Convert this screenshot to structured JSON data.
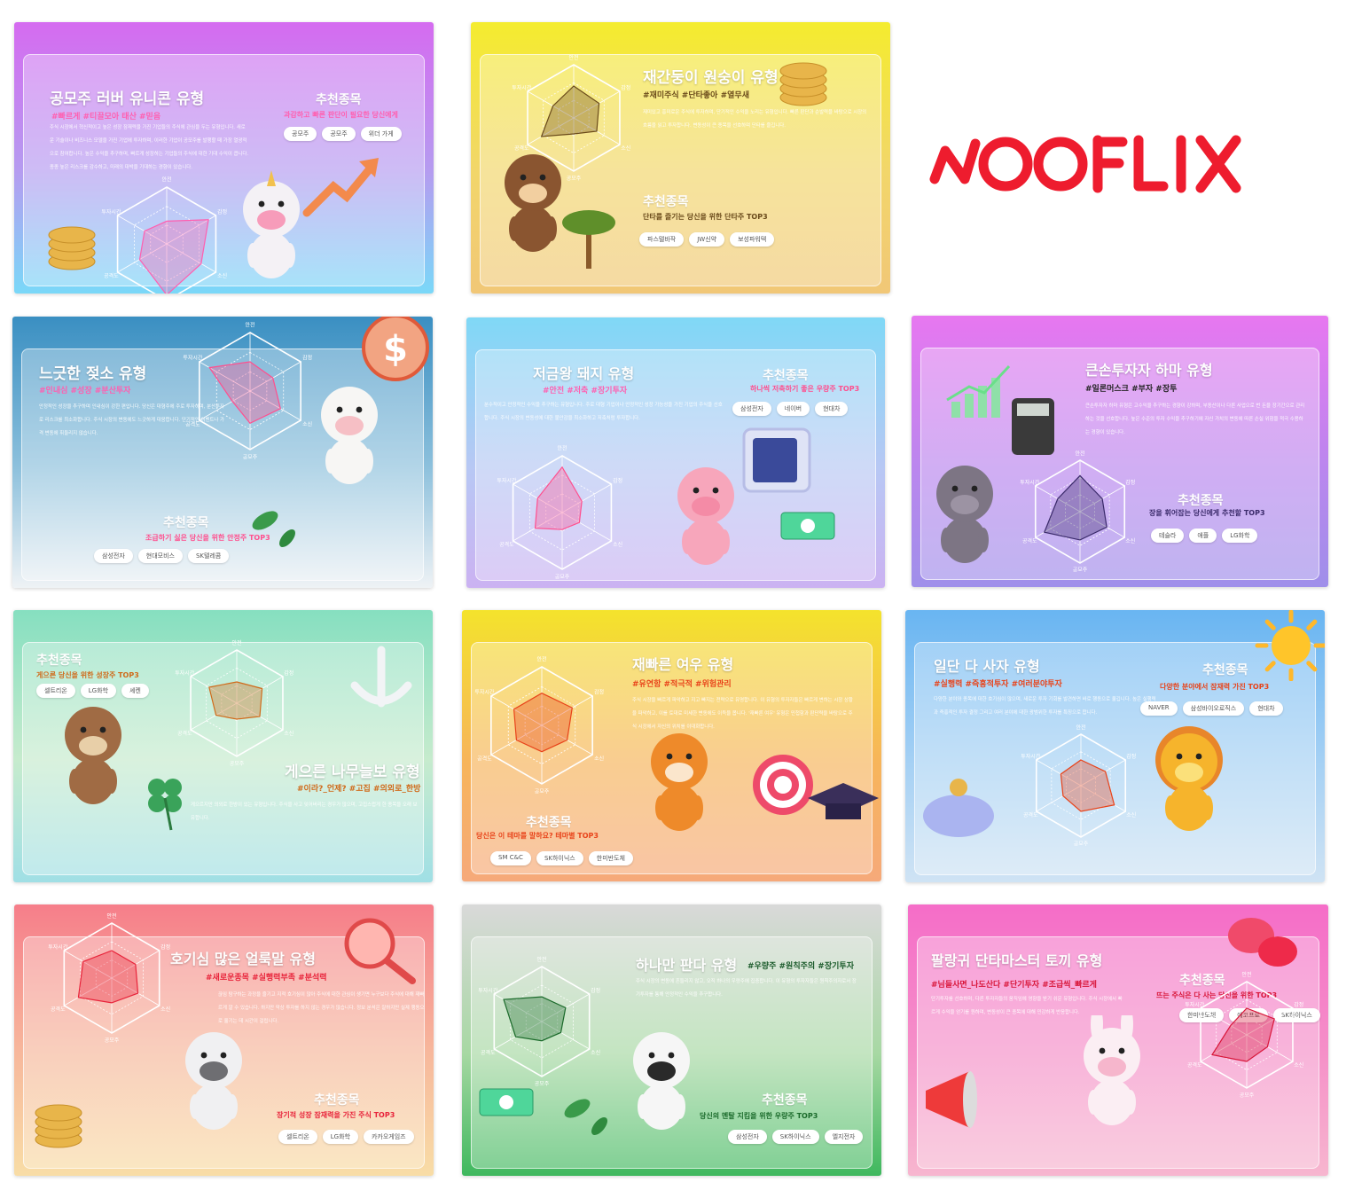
{
  "logo": {
    "text": "NOOFLIX",
    "color": "#ee1c2e"
  },
  "radar_axes": [
    "안전",
    "감정",
    "소신",
    "공모주",
    "공격도",
    "투자시간"
  ],
  "cards": [
    {
      "id": "unicorn",
      "mascot": "unicorn-icon",
      "bg": [
        "#d56bf0",
        "#b59cf0",
        "#7ad8f8"
      ],
      "title": "공모주 러버 유니콘 유형",
      "tags": "#빠르게 #티끌모아 태산 #믿음",
      "tag_color": "#ff5fb0",
      "desc": "주식 시장에서 혁신적이고 높은 성장 잠재력을 가진 기업들의 주식에 관심을 두는 유형입니다. 새로운 기술이나 비즈니스 모델을 가진 기업에 투자하며, 이러한 기업이 공모주를 발행할 때 가장 열광적으로 참여합니다. 높은 수익을 추구하며, 빠르게 성장하는 기업들의 주식에 대한 기대 수익이 큽니다. 종종 높은 리스크를 감수하고, 미래의 대박을 기대하는 경향이 있습니다.",
      "rec_title": "추천종목",
      "rec_sub": "과감하고 빠른 판단이 필요한 당신에게",
      "rec_color": "#ff5fb0",
      "stocks": [
        "공모주",
        "공모주",
        "위더 가게"
      ],
      "radar": [
        0.4,
        0.85,
        0.7,
        0.9,
        0.55,
        0.45
      ]
    },
    {
      "id": "monkey",
      "mascot": "monkey-icon",
      "bg": [
        "#f4ec2e",
        "#f2d66a",
        "#f1c777"
      ],
      "title": "재간둥이 원숭이 유형",
      "tags": "#재미주식 #단타좋아 #열무새",
      "tag_color": "#6a4a1a",
      "desc": "재미있고 흥미로운 주식에 투자하며, 단기적인 수익을 노리는 유형입니다. 빠른 판단과 순발력을 바탕으로 시장의 흐름을 읽고 투자합니다. 변동성이 큰 종목을 선호하며 단타를 즐깁니다.",
      "rec_title": "추천종목",
      "rec_sub": "단타를 즐기는 당신을 위한 단타주 TOP3",
      "rec_color": "#6a4a1a",
      "stocks": [
        "파스텔바작",
        "JW신약",
        "보성파워텍"
      ],
      "radar": [
        0.6,
        0.55,
        0.5,
        0.3,
        0.7,
        0.45
      ]
    },
    {
      "id": "cow",
      "mascot": "cow-icon",
      "bg": [
        "#3a8fc2",
        "#8cc0dc",
        "#eef2f5"
      ],
      "title": "느긋한 젖소 유형",
      "tags": "#인내심 #성장 #분산투자",
      "tag_color": "#ff5fb0",
      "desc": "안정적인 성장을 추구하며 인내심이 강한 편입니다. 당신은 대형주에 주로 투자하며, 분산투자로 리스크를 최소화합니다. 주식 시장의 변동에도 느긋하게 대응합니다. 단기적인 이벤트나 가격 변동에 휘둘리지 않습니다.",
      "rec_title": "추천종목",
      "rec_sub": "조급하기 싫은 당신을 위한 안정주 TOP3",
      "rec_color": "#ff4f8e",
      "stocks": [
        "삼성전자",
        "현대모비스",
        "SK텔레콤"
      ],
      "radar": [
        0.5,
        0.45,
        0.6,
        0.55,
        0.35,
        0.8
      ]
    },
    {
      "id": "pig",
      "mascot": "pig-icon",
      "bg": [
        "#80d8f6",
        "#b7c8f4",
        "#cbb2f2"
      ],
      "title": "저금왕 돼지 유형",
      "tags": "#안전 #저축 #장기투자",
      "tag_color": "#ff5fb0",
      "desc": "분수적이고 안정적인 수익을 추구하는 유형입니다. 주로 대형 기업이나 안정적인 성장 가능성을 가진 기업의 주식을 선호합니다. 주식 시장의 변동성에 대한 불안감을 최소화하고 저축처럼 투자합니다.",
      "rec_title": "추천종목",
      "rec_sub": "하나씩 저축하기 좋은 우량주 TOP3",
      "rec_color": "#ff4f8e",
      "stocks": [
        "삼성전자",
        "네이버",
        "현대차"
      ],
      "radar": [
        0.8,
        0.4,
        0.35,
        0.3,
        0.55,
        0.5
      ]
    },
    {
      "id": "hippo",
      "mascot": "hippo-icon",
      "bg": [
        "#e777f0",
        "#bb86ee",
        "#9f8fea"
      ],
      "title": "큰손투자자 하마 유형",
      "tags": "#일론머스크 #부자 #장투",
      "tag_color": "#222222",
      "desc": "큰손투자자 하마 유형은 고수익을 추구하는 경향이 강하며, 부동산이나 다른 사업으로 번 돈을 장기간으로 관리하는 것을 선호합니다. 높은 수준의 투자 수익을 추구하기에 자신 가치의 변동에 따른 손실 위험을 적극 수용하는 경향이 있습니다.",
      "rec_title": "추천종목",
      "rec_sub": "장을 휘어잡는 당신에게 추천할 TOP3",
      "rec_color": "#3a2a6a",
      "stocks": [
        "테슬라",
        "애플",
        "LG화학"
      ],
      "radar": [
        0.7,
        0.5,
        0.6,
        0.55,
        0.8,
        0.5
      ]
    },
    {
      "id": "sloth",
      "mascot": "sloth-icon",
      "bg": [
        "#86dfc0",
        "#c6ebcd",
        "#a0dfe5"
      ],
      "title": "게으른 나무늘보 유형",
      "tags": "#이라?_언제? #고집 #의외로_한방",
      "tag_color": "#d06a1a",
      "desc": "게으르지만 의외로 한방이 있는 유형입니다. 주식을 사고 잊어버리는 경우가 많으며, 고집스럽게 한 종목을 오래 보유합니다.",
      "rec_title": "추천종목",
      "rec_sub": "게으른 당신을 위한 성장주 TOP3",
      "rec_color": "#d06a1a",
      "stocks": [
        "셀트리온",
        "LG화학",
        "셰켄"
      ],
      "radar": [
        0.4,
        0.55,
        0.5,
        0.3,
        0.45,
        0.6
      ]
    },
    {
      "id": "fox",
      "mascot": "fox-icon",
      "bg": [
        "#f4e32c",
        "#f7b55a",
        "#f6a97a"
      ],
      "title": "재빠른 여우 유형",
      "tags": "#유연함 #적극적 #위험관리",
      "tag_color": "#e8431a",
      "desc": "주식 시장을 빠르게 파악하고 지고 빠지는 전략으로 유명합니다. 이 유형의 투자자들은 빠르게 변하는 시장 상황을 파악하고, 이를 토대로 미세한 변동에도 이득을 봅니다. '재빠른 여우' 유형은 민첩함과 판단력을 바탕으로 주식 시장에서 자신의 위치를 이대화합니다.",
      "rec_title": "추천종목",
      "rec_sub": "당신은 이 테마를 말하요? 테마별 TOP3",
      "rec_color": "#e8431a",
      "stocks": [
        "SM C&C",
        "SK하이닉스",
        "한미반도체"
      ],
      "radar": [
        0.55,
        0.6,
        0.5,
        0.45,
        0.5,
        0.55
      ]
    },
    {
      "id": "lion",
      "mascot": "lion-icon",
      "bg": [
        "#69b5f2",
        "#a4d0f4",
        "#cfe3f4"
      ],
      "title": "일단 다 사자 유형",
      "tags": "#실행력 #즉흥적투자 #여러분야투자",
      "tag_color": "#e8431a",
      "desc": "다양한 분야와 종목에 대한 호기심이 많으며, 새로운 투자 기회를 발견하면 바로 행동으로 옮깁니다. 높은 실행력과 즉흥적인 투자 결정 그리고 여러 분야에 대한 광범위한 투자를 특징으로 합니다.",
      "rec_title": "추천종목",
      "rec_sub": "다양한 분야에서 잠재력 가진 TOP3",
      "rec_color": "#e8431a",
      "stocks": [
        "NAVER",
        "삼성바이오로직스",
        "현대차"
      ],
      "radar": [
        0.5,
        0.55,
        0.75,
        0.5,
        0.4,
        0.45
      ]
    },
    {
      "id": "zebra",
      "mascot": "zebra-icon",
      "bg": [
        "#f67e8a",
        "#f7b89c",
        "#f8dda6"
      ],
      "title": "호기심 많은 얼룩말 유형",
      "tags": "#새로운종목 #실행력부족 #분석력",
      "tag_color": "#e8233a",
      "desc": "끊임 탐구하는 과정을 즐기고 지적 호기심이 많아 주식에 대한 관심이 생기면 누구보다 주식에 대해 재빠르게 알 수 있습니다. 하지만 막상 투자를 하지 않는 경우가 많습니다. 정보 분석은 잘하지만 실제 행동으로 옮기는 데 시간이 걸립니다.",
      "rec_title": "추천종목",
      "rec_sub": "장기적 성장 잠재력을 가진 주식 TOP3",
      "rec_color": "#e8233a",
      "stocks": [
        "셀트리온",
        "LG화학",
        "카카오게임즈"
      ],
      "radar": [
        0.5,
        0.5,
        0.55,
        0.45,
        0.7,
        0.6
      ]
    },
    {
      "id": "panda",
      "mascot": "panda-icon",
      "bg": [
        "#d9d9d9",
        "#a7d8a3",
        "#3fb85e"
      ],
      "title": "하나만 판다 유형",
      "tags": "#우량주 #원칙주의 #장기투자",
      "tag_color": "#1a5a2a",
      "desc": "주식 시장의 변동에 흔들리지 않고, 오직 하나의 우량주에 집중합니다. 이 유형의 투자자들은 원칙주의자로서 장기투자를 통해 안정적인 수익을 추구합니다.",
      "rec_title": "추천종목",
      "rec_sub": "당신의 멘탈 지킴을 위한 우량주 TOP3",
      "rec_color": "#1a6a2a",
      "stocks": [
        "삼성전자",
        "SK하이닉스",
        "엘지전자"
      ],
      "radar": [
        0.45,
        0.5,
        0.4,
        0.35,
        0.55,
        0.8
      ]
    },
    {
      "id": "rabbit",
      "mascot": "rabbit-icon",
      "bg": [
        "#f56dc8",
        "#f590c8",
        "#f7b6cf"
      ],
      "title": "팔랑귀 단타마스터 토끼 유형",
      "tags": "#님들사면_나도산다 #단기투자 #조급씩_빠르게",
      "tag_color": "#d8163a",
      "desc": "단기투자를 선호하며, 다른 투자자들의 움직임에 영향을 받기 쉬운 유형입니다. 주식 시장에서 빠르게 수익을 얻기를 원하며, 변동성이 큰 종목에 대해 민감하게 반응합니다.",
      "rec_title": "추천종목",
      "rec_sub": "뜨는 주식은 다 사는 당신을 위한 TOP3",
      "rec_color": "#d8163a",
      "stocks": [
        "한미반도체",
        "에코프로",
        "SK하이닉스"
      ],
      "radar": [
        0.5,
        0.6,
        0.45,
        0.5,
        0.75,
        0.35
      ]
    }
  ]
}
